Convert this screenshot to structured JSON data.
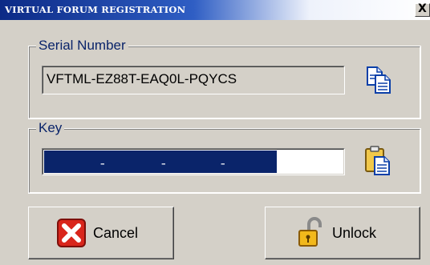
{
  "window": {
    "title": "VIRTUAL FORUM REGISTRATION",
    "close_glyph": "X"
  },
  "serial_group": {
    "legend": "Serial Number",
    "value": "VFTML-EZ88T-EAQ0L-PQYCS",
    "copy_icon": "copy-icon"
  },
  "key_group": {
    "legend": "Key",
    "dashes": [
      "-",
      "-",
      "-"
    ],
    "paste_icon": "paste-icon"
  },
  "buttons": {
    "cancel_label": "Cancel",
    "cancel_icon": "red-x-icon",
    "unlock_label": "Unlock",
    "unlock_icon": "padlock-open-icon"
  },
  "colors": {
    "title_start": "#0c2a86",
    "legend_text": "#0a246a",
    "selection": "#0a246a",
    "cancel_red": "#d9261c"
  }
}
